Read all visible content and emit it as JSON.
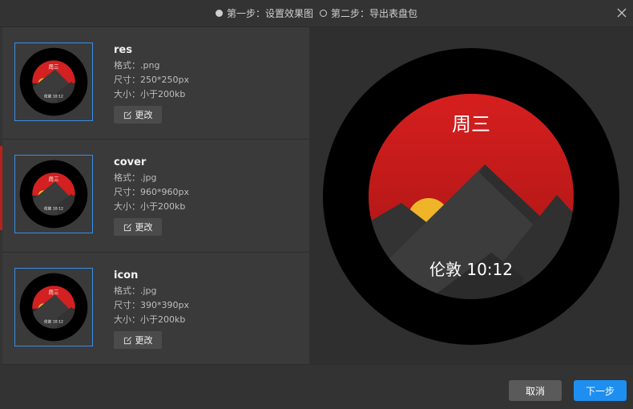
{
  "steps": [
    {
      "label": "第一步：设置效果图",
      "state": "filled"
    },
    {
      "label": "第二步：导出表盘包",
      "state": "empty"
    }
  ],
  "assets": [
    {
      "name": "res",
      "format": "格式：.png",
      "size": "尺寸：250*250px",
      "limit": "大小：小于200kb",
      "change_label": "更改"
    },
    {
      "name": "cover",
      "format": "格式：.jpg",
      "size": "尺寸：960*960px",
      "limit": "大小：小于200kb",
      "change_label": "更改"
    },
    {
      "name": "icon",
      "format": "格式：.jpg",
      "size": "尺寸：390*390px",
      "limit": "大小：小于200kb",
      "change_label": "更改"
    }
  ],
  "watch_face": {
    "weekday": "周三",
    "city_time": "伦敦 10:12"
  },
  "footer": {
    "cancel_label": "取消",
    "next_label": "下一步"
  },
  "colors": {
    "accent": "#1f8ef1",
    "face_red": "#d32020",
    "sun": "#f0b429",
    "mountain": "#3a3a3a"
  }
}
